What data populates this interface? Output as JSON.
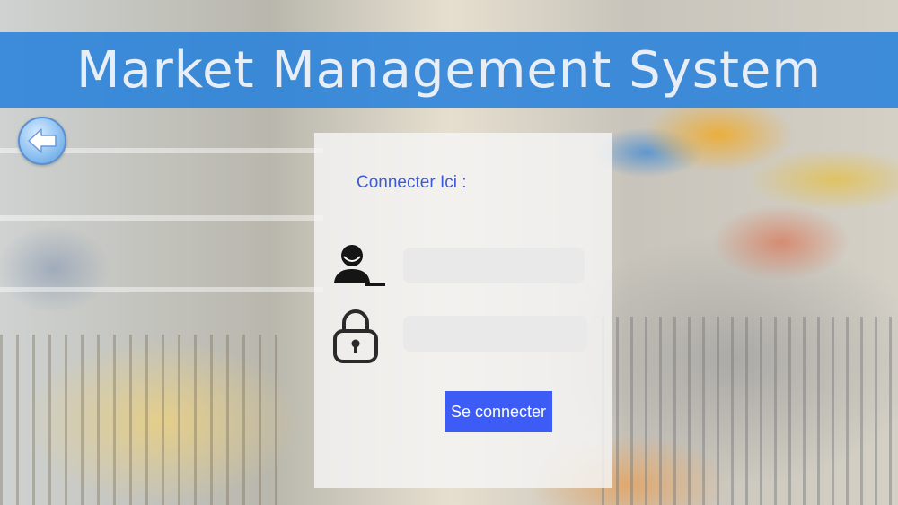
{
  "app": {
    "title": "Market Management System"
  },
  "login": {
    "heading": "Connecter Ici :",
    "username": {
      "value": "",
      "placeholder": ""
    },
    "password": {
      "value": "",
      "placeholder": ""
    },
    "submit_label": "Se connecter"
  },
  "icons": {
    "back": "back-arrow-icon",
    "user": "user-icon",
    "lock": "lock-icon"
  },
  "colors": {
    "title_bar": "#2882dc",
    "title_text": "#e8eef5",
    "heading_text": "#3d5ad8",
    "button_bg": "#3d5cf5",
    "button_text": "#ffffff",
    "panel_bg": "#f5f5f5"
  }
}
